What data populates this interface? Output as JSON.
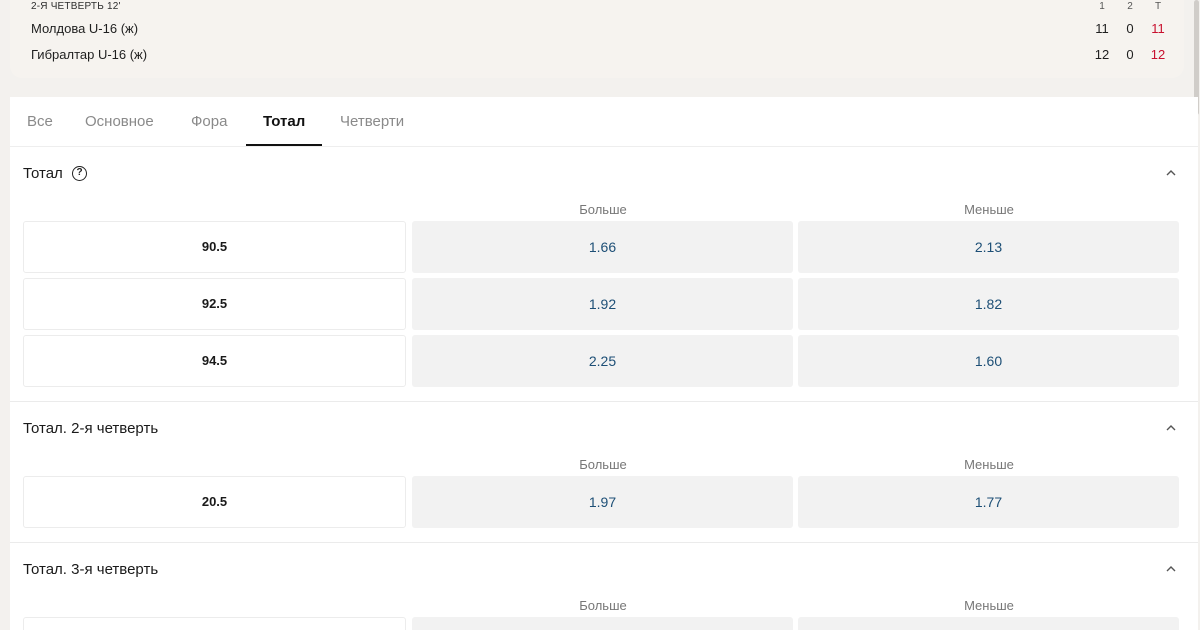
{
  "scoreboard": {
    "period": "2-Я ЧЕТВЕРТЬ 12'",
    "headers": [
      "1",
      "2",
      "Т"
    ],
    "teams": [
      {
        "name": "Молдова U-16 (ж)",
        "scores": [
          "11",
          "0",
          "11"
        ]
      },
      {
        "name": "Гибралтар U-16 (ж)",
        "scores": [
          "12",
          "0",
          "12"
        ]
      }
    ]
  },
  "tabs": [
    "Все",
    "Основное",
    "Фора",
    "Тотал",
    "Четверти"
  ],
  "active_tab": "Тотал",
  "sections": [
    {
      "title": "Тотал",
      "col_over": "Больше",
      "col_under": "Меньше",
      "rows": [
        {
          "line": "90.5",
          "over": "1.66",
          "under": "2.13"
        },
        {
          "line": "92.5",
          "over": "1.92",
          "under": "1.82"
        },
        {
          "line": "94.5",
          "over": "2.25",
          "under": "1.60"
        }
      ]
    },
    {
      "title": "Тотал. 2-я четверть",
      "col_over": "Больше",
      "col_under": "Меньше",
      "rows": [
        {
          "line": "20.5",
          "over": "1.97",
          "under": "1.77"
        }
      ]
    },
    {
      "title": "Тотал. 3-я четверть",
      "col_over": "Больше",
      "col_under": "Меньше",
      "rows": []
    }
  ],
  "colors": {
    "accent_total": "#c8102e",
    "odd_text": "#1d4f76"
  }
}
